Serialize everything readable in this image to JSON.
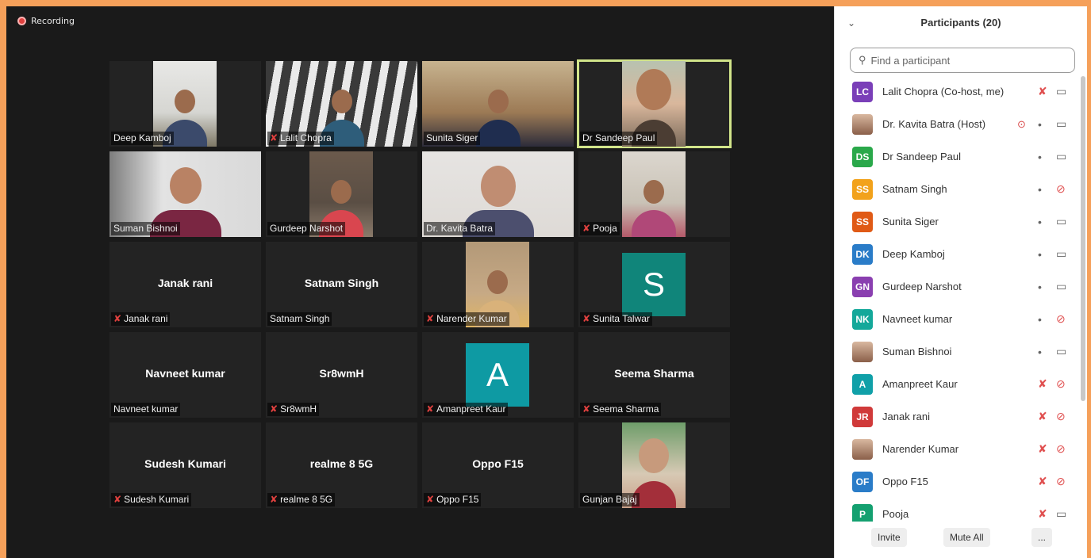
{
  "recording": {
    "label": "Recording"
  },
  "tiles": [
    {
      "name": "Deep Kamboj",
      "muted": false,
      "kind": "photo",
      "photo": "p1"
    },
    {
      "name": "Lalit Chopra",
      "muted": true,
      "kind": "photo-wide",
      "photo": "p2"
    },
    {
      "name": "Sunita Siger",
      "muted": false,
      "kind": "photo-wide",
      "photo": "p3"
    },
    {
      "name": "Dr Sandeep Paul",
      "muted": false,
      "kind": "photo",
      "photo": "p4",
      "active": true
    },
    {
      "name": "Suman Bishnoi",
      "muted": false,
      "kind": "photo-wide",
      "photo": "p5"
    },
    {
      "name": "Gurdeep Narshot",
      "muted": false,
      "kind": "photo",
      "photo": "p6"
    },
    {
      "name": "Dr. Kavita Batra",
      "muted": false,
      "kind": "photo-wide",
      "photo": "p7"
    },
    {
      "name": "Pooja",
      "muted": true,
      "kind": "photo",
      "photo": "p8"
    },
    {
      "name": "Janak rani",
      "muted": true,
      "kind": "text",
      "big": "Janak rani"
    },
    {
      "name": "Satnam Singh",
      "muted": false,
      "kind": "text",
      "big": "Satnam Singh"
    },
    {
      "name": "Narender Kumar",
      "muted": true,
      "kind": "photo",
      "photo": "p9"
    },
    {
      "name": "Sunita Talwar",
      "muted": true,
      "kind": "letter",
      "letter": "S",
      "color": "#10857a"
    },
    {
      "name": "Navneet kumar",
      "muted": false,
      "kind": "text",
      "big": "Navneet kumar"
    },
    {
      "name": "Sr8wmH",
      "muted": true,
      "kind": "text",
      "big": "Sr8wmH"
    },
    {
      "name": "Amanpreet Kaur",
      "muted": true,
      "kind": "letter",
      "letter": "A",
      "color": "#0e9aa3"
    },
    {
      "name": "Seema Sharma",
      "muted": true,
      "kind": "text",
      "big": "Seema Sharma"
    },
    {
      "name": "Sudesh Kumari",
      "muted": true,
      "kind": "text",
      "big": "Sudesh Kumari"
    },
    {
      "name": "realme 8 5G",
      "muted": true,
      "kind": "text",
      "big": "realme 8 5G"
    },
    {
      "name": "Oppo F15",
      "muted": true,
      "kind": "text",
      "big": "Oppo F15"
    },
    {
      "name": "Gunjan Bajaj",
      "muted": false,
      "kind": "photo",
      "photo": "p10"
    }
  ],
  "panel": {
    "title": "Participants (20)",
    "search_placeholder": "Find a participant",
    "participants": [
      {
        "initials": "LC",
        "color": "#7a3fb8",
        "name": "Lalit Chopra (Co-host, me)",
        "mic": "off",
        "cam": "on"
      },
      {
        "initials": "",
        "color": "photo",
        "name": "Dr. Kavita Batra (Host)",
        "mic": "on",
        "cam": "on",
        "rec": true
      },
      {
        "initials": "DS",
        "color": "#2aa84a",
        "name": "Dr Sandeep Paul",
        "mic": "active",
        "cam": "on"
      },
      {
        "initials": "SS",
        "color": "#f2a21c",
        "name": "Satnam Singh",
        "mic": "on",
        "cam": "off"
      },
      {
        "initials": "SS",
        "color": "#e05a16",
        "name": "Sunita Siger",
        "mic": "on",
        "cam": "on"
      },
      {
        "initials": "DK",
        "color": "#2a7cc8",
        "name": "Deep Kamboj",
        "mic": "on",
        "cam": "on"
      },
      {
        "initials": "GN",
        "color": "#8a3fb0",
        "name": "Gurdeep Narshot",
        "mic": "on",
        "cam": "on"
      },
      {
        "initials": "NK",
        "color": "#14a89a",
        "name": "Navneet kumar",
        "mic": "on",
        "cam": "off"
      },
      {
        "initials": "",
        "color": "photo",
        "name": "Suman Bishnoi",
        "mic": "on",
        "cam": "on"
      },
      {
        "initials": "A",
        "color": "#10a0a8",
        "name": "Amanpreet Kaur",
        "mic": "off",
        "cam": "off"
      },
      {
        "initials": "JR",
        "color": "#d03a3a",
        "name": "Janak rani",
        "mic": "off",
        "cam": "off"
      },
      {
        "initials": "",
        "color": "photo",
        "name": "Narender Kumar",
        "mic": "off",
        "cam": "off"
      },
      {
        "initials": "OF",
        "color": "#2a7cc8",
        "name": "Oppo F15",
        "mic": "off",
        "cam": "off"
      },
      {
        "initials": "P",
        "color": "#14a070",
        "name": "Pooja",
        "mic": "off",
        "cam": "on"
      }
    ],
    "buttons": {
      "invite": "Invite",
      "mute_all": "Mute All",
      "more": "..."
    }
  }
}
